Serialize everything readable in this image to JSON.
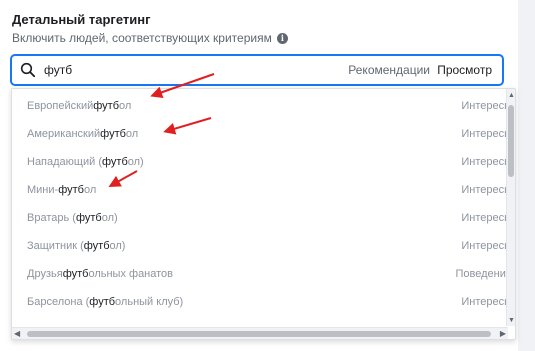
{
  "section": {
    "title": "Детальный таргетинг",
    "subtitle": "Включить людей, соответствующих критериям"
  },
  "search": {
    "value": "футб",
    "recommendations_label": "Рекомендации",
    "browse_label": "Просмотр"
  },
  "suggestions": [
    {
      "before": "Европейский ",
      "match": "футб",
      "after": "ол",
      "category": "Интересы"
    },
    {
      "before": "Американский ",
      "match": "футб",
      "after": "ол",
      "category": "Интересы"
    },
    {
      "before": "Нападающий (",
      "match": "футб",
      "after": "ол)",
      "category": "Интересы"
    },
    {
      "before": "Мини-",
      "match": "футб",
      "after": "ол",
      "category": "Интересы"
    },
    {
      "before": "Вратарь (",
      "match": "футб",
      "after": "ол)",
      "category": "Интересы"
    },
    {
      "before": "Защитник (",
      "match": "футб",
      "after": "ол)",
      "category": "Интересы"
    },
    {
      "before": "Друзья ",
      "match": "футб",
      "after": "ольных фанатов",
      "category": "Поведение"
    },
    {
      "before": "Барселона (",
      "match": "футб",
      "after": "ольный клуб)",
      "category": "Интересы"
    }
  ],
  "colors": {
    "accent": "#1877f2",
    "annotation_arrow": "#e02020"
  },
  "icons": [
    "info-icon",
    "search-icon",
    "red-arrow-icon"
  ]
}
